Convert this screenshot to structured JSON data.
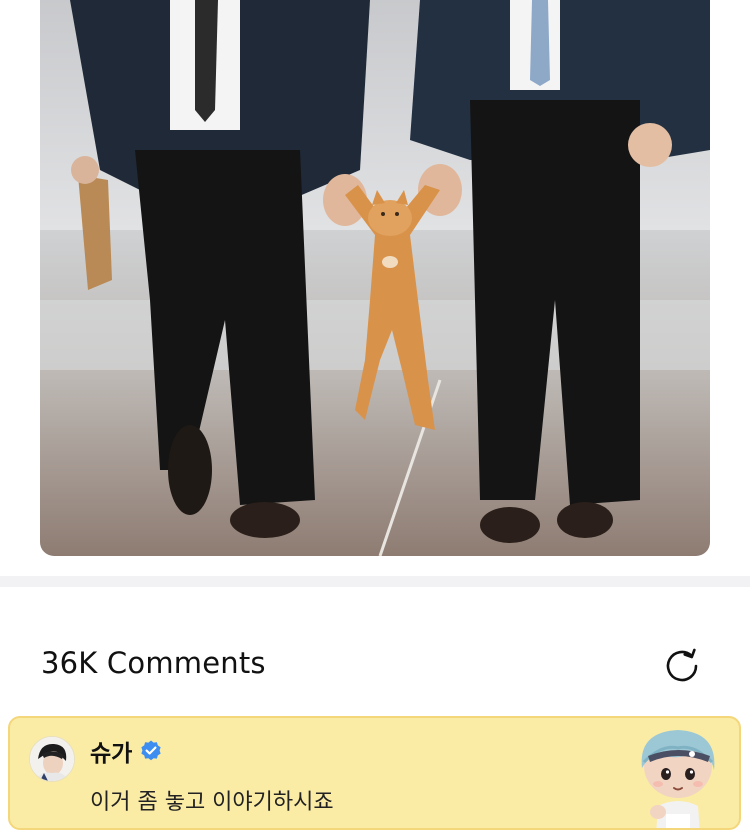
{
  "post": {
    "image_description_icon": "photo-two-men-carrying-cat"
  },
  "comments": {
    "count_label": "36K Comments",
    "refresh_icon": "refresh-icon"
  },
  "highlighted_comment": {
    "author": "슈가",
    "verified": true,
    "text": "이거 좀 놓고 이야기하시죠",
    "sticker_icon": "character-sticker-icon"
  },
  "colors": {
    "card_bg": "#faeba5",
    "card_border": "#f3d77a",
    "verified": "#3d8ef0",
    "separator": "#f2f2f5"
  }
}
